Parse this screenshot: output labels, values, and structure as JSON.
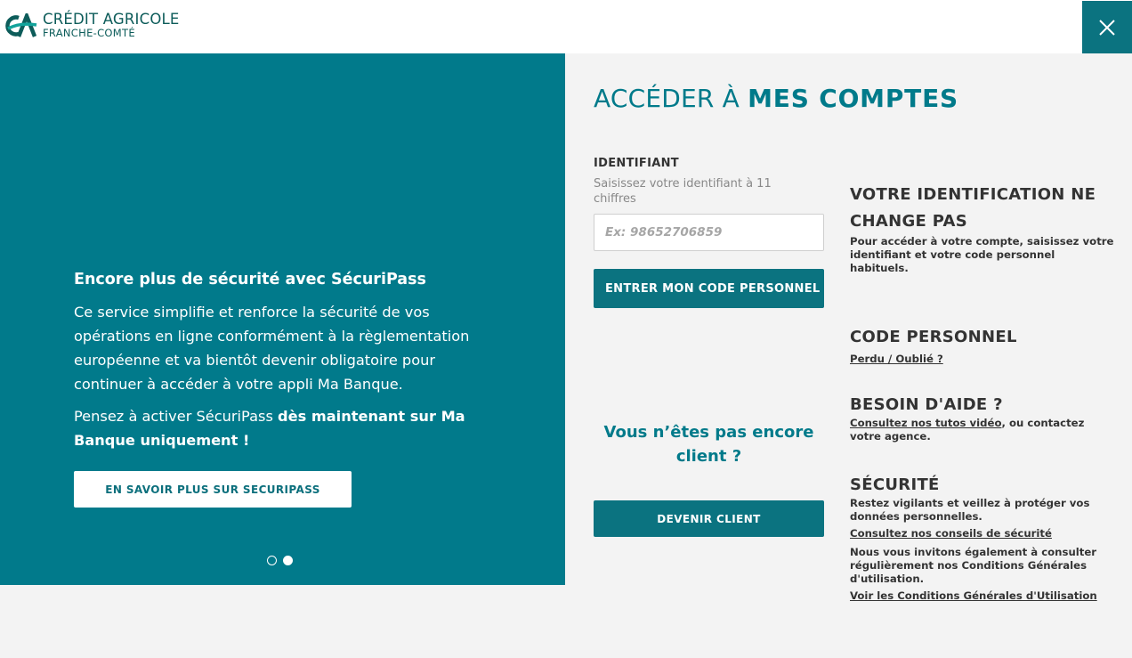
{
  "header": {
    "logo_line1": "CRÉDIT AGRICOLE",
    "logo_line2": "FRANCHE-COMTÉ",
    "close_icon": "close-icon"
  },
  "colors": {
    "teal": "#017a8b",
    "teal_dark": "#0b7380",
    "logo_green": "#0d5c5a",
    "background": "#f3f3f3"
  },
  "promo": {
    "title": "Encore plus de sécurité avec SécuriPass",
    "text": "Ce service simplifie et renforce la sécurité de vos opérations en ligne conformément à la règlementation européenne et va bientôt devenir obligatoire pour continuer à accéder à votre appli Ma Banque.",
    "text2_plain": "Pensez à activer SécuriPass ",
    "text2_bold": "dès maintenant sur Ma Banque uniquement !",
    "button_label": "EN SAVOIR PLUS SUR SECURIPASS",
    "slides": [
      {
        "active": false
      },
      {
        "active": true
      }
    ]
  },
  "login": {
    "title_plain": "ACCÉDER À ",
    "title_bold": "MES COMPTES",
    "id_label": "IDENTIFIANT",
    "id_hint": "Saisissez votre identifiant à 11 chiffres",
    "id_placeholder": "Ex: 98652706859",
    "id_value": "",
    "code_button": "ENTRER MON CODE PERSONNEL",
    "not_client": "Vous n’êtes pas encore client ?",
    "become_client_button": "DEVENIR CLIENT"
  },
  "info": {
    "identification": {
      "heading": "VOTRE IDENTIFICATION NE CHANGE PAS",
      "text": "Pour accéder à votre compte, saisissez votre identifiant et votre code personnel habituels."
    },
    "code": {
      "heading": "CODE PERSONNEL",
      "link": "Perdu / Oublié ?"
    },
    "help": {
      "heading": "BESOIN D'AIDE ?",
      "link": "Consultez nos tutos vidéo",
      "text": ", ou contactez votre agence."
    },
    "security": {
      "heading": "SÉCURITÉ",
      "text": "Restez vigilants et veillez à protéger vos données personnelles.",
      "link": "Consultez nos conseils de sécurité"
    },
    "cgu": {
      "text": "Nous vous invitons également à consulter régulièrement nos Conditions Générales d'utilisation.",
      "link": "Voir les Conditions Générales d'Utilisation"
    }
  }
}
